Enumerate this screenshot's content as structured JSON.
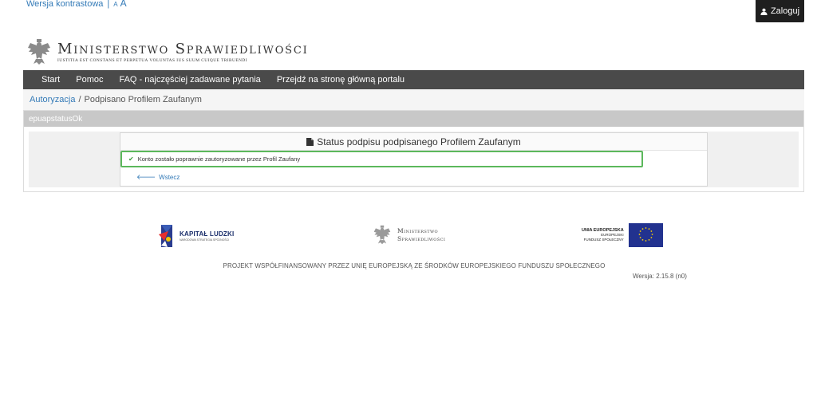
{
  "accessibility": {
    "contrast_label": "Wersja kontrastowa",
    "separator": "|",
    "font_small": "A",
    "font_big": "A"
  },
  "header": {
    "login_label": "Zaloguj",
    "logo_title": "Ministerstwo Sprawiedliwości",
    "logo_motto": "Iustitia est constans et perpetua voluntas ius suum cuique tribuendi"
  },
  "nav": {
    "items": [
      {
        "label": "Start"
      },
      {
        "label": "Pomoc"
      },
      {
        "label": "FAQ - najczęściej zadawane pytania"
      },
      {
        "label": "Przejdź na stronę główną portalu"
      }
    ]
  },
  "breadcrumb": {
    "link": "Autoryzacja",
    "separator": "/",
    "current": "Podpisano Profilem Zaufanym"
  },
  "panel": {
    "heading": "epuapstatusOk",
    "card_title": "Status podpisu podpisanego Profilem Zaufanym",
    "alert_text": "Konto zostało poprawnie zautoryzowane przez Profil Zaufany",
    "back_label": "Wstecz"
  },
  "footer": {
    "kl_title": "KAPITAŁ LUDZKI",
    "kl_subtitle": "NARODOWA STRATEGIA SPÓJNOŚCI",
    "ms_line1": "Ministerstwo",
    "ms_line2": "Sprawiedliwości",
    "eu_line1": "UNIA EUROPEJSKA",
    "eu_line2": "EUROPEJSKI",
    "eu_line3": "FUNDUSZ SPOŁECZNY",
    "project_text": "PROJEKT WSPÓŁFINANSOWANY PRZEZ UNIĘ EUROPEJSKĄ ZE ŚRODKÓW EUROPEJSKIEGO FUNDUSZU SPOŁECZNEGO",
    "version": "Wersja: 2.15.8 (n0)"
  },
  "colors": {
    "nav_bg": "#4a4a4a",
    "link": "#337ab7",
    "success_border": "#5cb85c",
    "eu_blue": "#22328f",
    "eu_star": "#ffd200"
  },
  "icons": {
    "login": "user-icon",
    "card": "file-icon",
    "alert": "check-icon",
    "back": "arrow-left-icon"
  }
}
